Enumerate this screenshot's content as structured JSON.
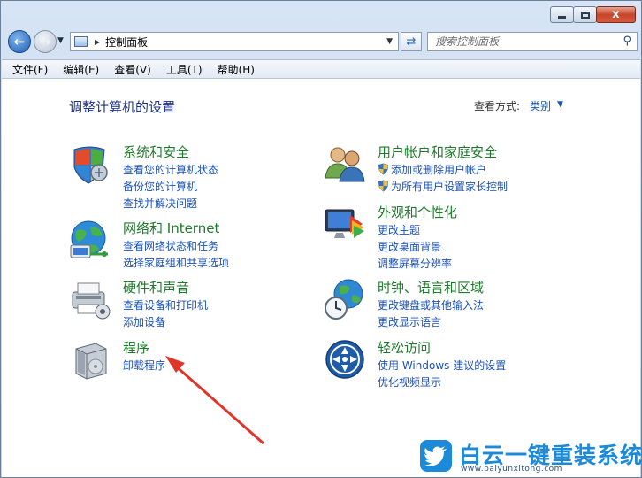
{
  "window": {
    "caption_close": "x"
  },
  "address_bar": {
    "crumb": "控制面板"
  },
  "search": {
    "placeholder": "搜索控制面板"
  },
  "menu": [
    "文件(F)",
    "编辑(E)",
    "查看(V)",
    "工具(T)",
    "帮助(H)"
  ],
  "content": {
    "title": "调整计算机的设置",
    "view_by_label": "查看方式:",
    "view_by_value": "类别"
  },
  "categories": [
    {
      "title": "系统和安全",
      "icon": "shield-icon",
      "links": [
        "查看您的计算机状态",
        "备份您的计算机",
        "查找并解决问题"
      ]
    },
    {
      "title": "网络和 Internet",
      "icon": "network-globe-icon",
      "links": [
        "查看网络状态和任务",
        "选择家庭组和共享选项"
      ]
    },
    {
      "title": "硬件和声音",
      "icon": "printer-icon",
      "links": [
        "查看设备和打印机",
        "添加设备"
      ]
    },
    {
      "title": "程序",
      "icon": "programs-box-icon",
      "links": [
        "卸载程序"
      ]
    },
    {
      "title": "用户帐户和家庭安全",
      "icon": "users-icon",
      "links": [
        "添加或删除用户帐户",
        "为所有用户设置家长控制"
      ]
    },
    {
      "title": "外观和个性化",
      "icon": "monitor-colors-icon",
      "links": [
        "更改主题",
        "更改桌面背景",
        "调整屏幕分辨率"
      ]
    },
    {
      "title": "时钟、语言和区域",
      "icon": "clock-globe-icon",
      "links": [
        "更改键盘或其他输入法",
        "更改显示语言"
      ]
    },
    {
      "title": "轻松访问",
      "icon": "ease-of-access-icon",
      "links": [
        "使用 Windows 建议的设置",
        "优化视频显示"
      ]
    }
  ],
  "watermark": {
    "title": "白云一键重装系统",
    "url": "www.baiyunxitong.com"
  },
  "colors": {
    "category_title": "#1d7a2a",
    "link": "#1a52b8",
    "heading": "#1e3287",
    "watermark": "#1c8ad8",
    "arrow": "#e0352b"
  }
}
